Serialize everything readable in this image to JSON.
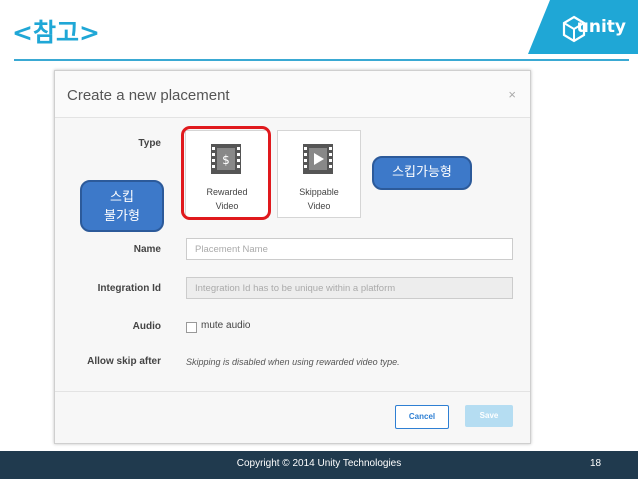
{
  "slide": {
    "title": "<참고>",
    "brand": "unity",
    "footer": "Copyright © 2014 Unity Technologies",
    "page_number": "18"
  },
  "dialog": {
    "title": "Create a new placement",
    "close": "×",
    "labels": {
      "type": "Type",
      "name": "Name",
      "integration_id": "Integration Id",
      "audio": "Audio",
      "allow_skip": "Allow skip after"
    },
    "types": [
      {
        "line1": "Rewarded",
        "line2": "Video",
        "icon": "dollar-film-icon",
        "selected": true
      },
      {
        "line1": "Skippable",
        "line2": "Video",
        "icon": "play-film-icon",
        "selected": false
      }
    ],
    "name_placeholder": "Placement Name",
    "integration_placeholder": "Integration Id has to be unique within a platform",
    "mute_label": "mute audio",
    "mute_checked": false,
    "skip_note": "Skipping is disabled when using rewarded video type.",
    "cancel_label": "Cancel",
    "save_label": "Save"
  },
  "callouts": {
    "left_line1": "스킵",
    "left_line2": "불가형",
    "right": "스킵가능형"
  },
  "colors": {
    "title": "#1fa7d6",
    "banner": "#1fa7d6",
    "callout": "#3d79c9",
    "highlight": "#e0191d",
    "footer": "#203a4e"
  }
}
